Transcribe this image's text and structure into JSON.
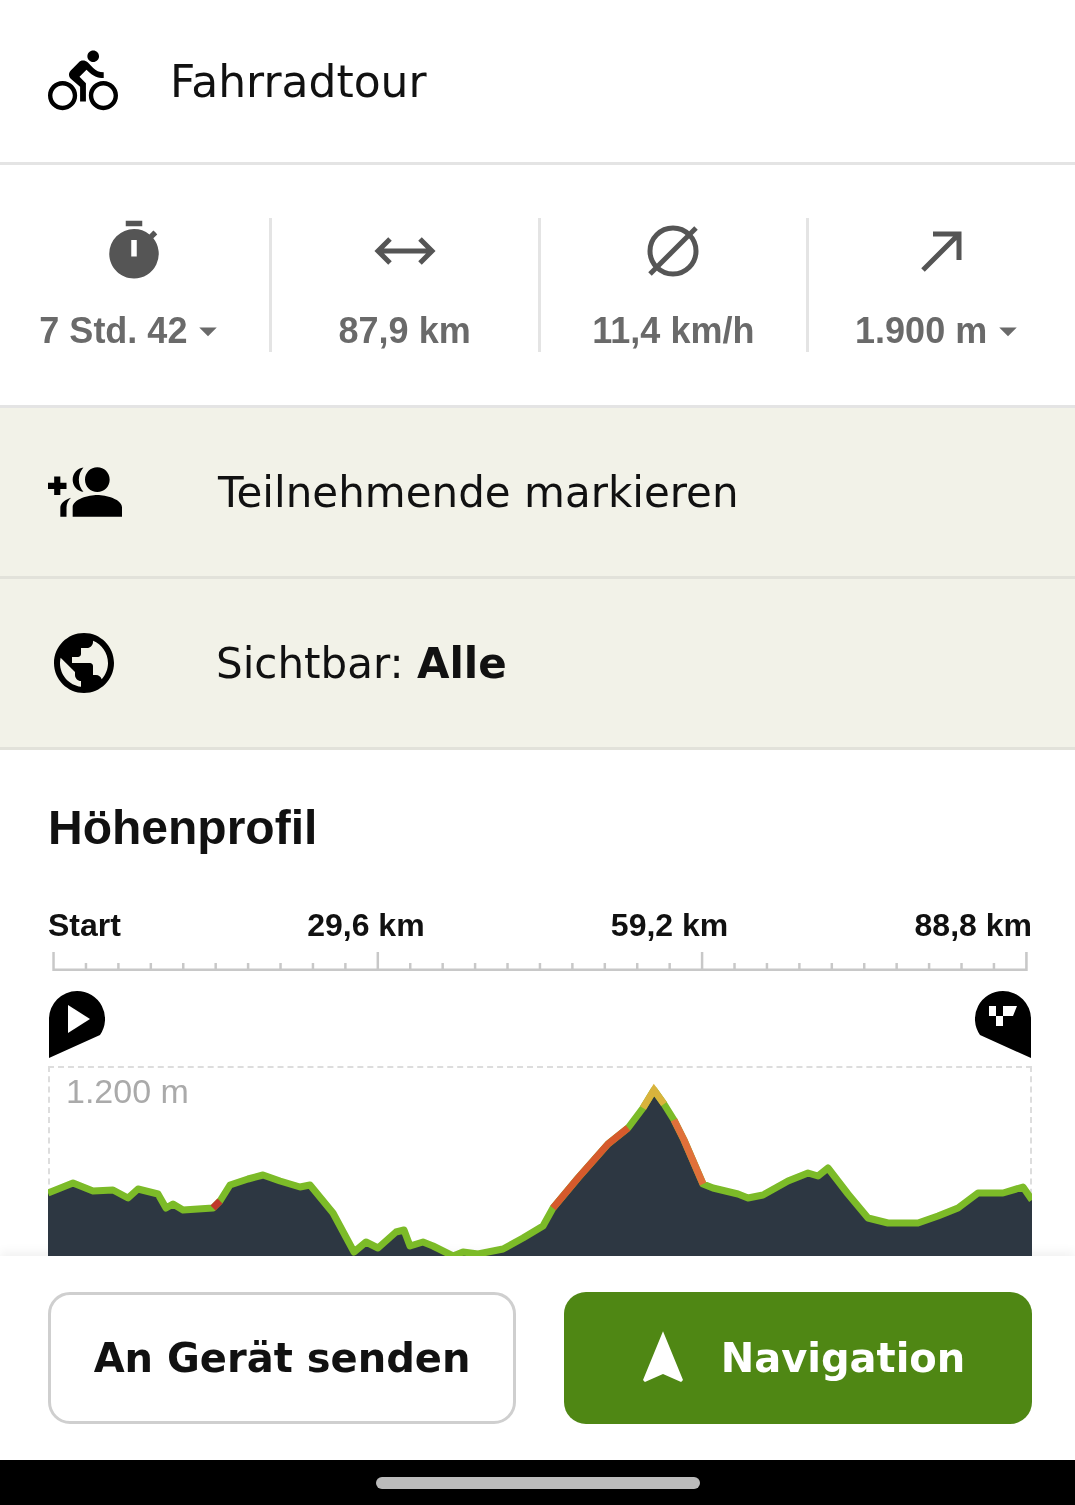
{
  "activity": {
    "label": "Fahrradtour"
  },
  "stats": [
    {
      "kind": "duration",
      "value": "7 Std. 42",
      "dropdown": true
    },
    {
      "kind": "distance",
      "value": "87,9 km",
      "dropdown": false
    },
    {
      "kind": "speed",
      "value": "11,4 km/h",
      "dropdown": false
    },
    {
      "kind": "ascent",
      "value": "1.900 m",
      "dropdown": true
    }
  ],
  "actions": [
    {
      "kind": "participants",
      "label": "Teilnehmende markieren"
    },
    {
      "kind": "visibility",
      "label": "Sichtbar: **Alle**"
    }
  ],
  "elevation_profile": {
    "title": "Höhenprofil",
    "axis_labels": [
      "Start",
      "29,6 km",
      "59,2 km",
      "88,8 km"
    ],
    "y_label": "1.200 m"
  },
  "buttons": [
    {
      "kind": "secondary",
      "label": "An Gerät senden"
    },
    {
      "kind": "primary",
      "label": "Navigation"
    }
  ]
}
